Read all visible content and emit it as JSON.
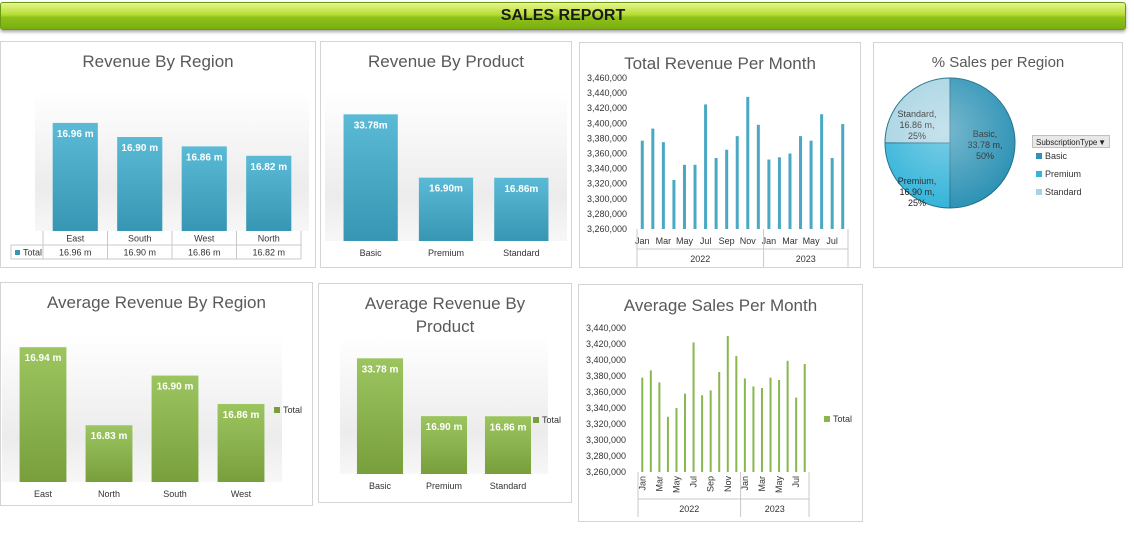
{
  "report_title": "SALES REPORT",
  "colors": {
    "blue": "#4aa8c3",
    "green": "#8ab64f",
    "banner": "#a6d22b"
  },
  "chart_data": [
    {
      "id": "rev_region",
      "type": "bar",
      "title": "Revenue By Region",
      "categories": [
        "East",
        "South",
        "West",
        "North"
      ],
      "values": [
        16.96,
        16.9,
        16.86,
        16.82
      ],
      "data_labels": [
        "16.96 m",
        "16.90 m",
        "16.86 m",
        "16.82 m"
      ],
      "data_table": {
        "row_label": "Total",
        "values": [
          "16.96 m",
          "16.90 m",
          "16.86 m",
          "16.82 m"
        ]
      },
      "ylim": [
        16.5,
        17.1
      ]
    },
    {
      "id": "rev_product",
      "type": "bar",
      "title": "Revenue By Product",
      "categories": [
        "Basic",
        "Premium",
        "Standard"
      ],
      "values": [
        33.78,
        16.9,
        16.86
      ],
      "data_labels": [
        "33.78m",
        "16.90m",
        "16.86m"
      ],
      "ylim": [
        0,
        40
      ]
    },
    {
      "id": "rev_month",
      "type": "bar",
      "title": "Total Revenue Per Month",
      "y_ticks": [
        "3,260,000",
        "3,280,000",
        "3,300,000",
        "3,320,000",
        "3,340,000",
        "3,360,000",
        "3,380,000",
        "3,400,000",
        "3,420,000",
        "3,440,000",
        "3,460,000"
      ],
      "ylim": [
        3260000,
        3460000
      ],
      "month_labels": [
        "Jan",
        "Mar",
        "May",
        "Jul",
        "Sep",
        "Nov",
        "Jan",
        "Mar",
        "May",
        "Jul"
      ],
      "years": [
        "2022",
        "2023"
      ],
      "values": [
        3377000,
        3393000,
        3375000,
        3325000,
        3345000,
        3345000,
        3425000,
        3354000,
        3365000,
        3383000,
        3435000,
        3398000,
        3352000,
        3355000,
        3360000,
        3383000,
        3377000,
        3412000,
        3354000,
        3399000
      ]
    },
    {
      "id": "pct_region",
      "type": "pie",
      "title": "% Sales per Region",
      "slices": [
        {
          "name": "Basic",
          "value": 33.78,
          "label": [
            "Basic,",
            "33.78 m,",
            "50%"
          ]
        },
        {
          "name": "Premium",
          "value": 16.9,
          "label": [
            "Premium,",
            "16.90 m,",
            "25%"
          ]
        },
        {
          "name": "Standard",
          "value": 16.86,
          "label": [
            "Standard,",
            "16.86 m,",
            "25%"
          ]
        }
      ],
      "legend_title": "SubscriptionType",
      "legend": [
        "Basic",
        "Premium",
        "Standard"
      ],
      "colors": [
        "#2f93b5",
        "#35b4d9",
        "#a7d3e2"
      ]
    },
    {
      "id": "avg_region",
      "type": "bar",
      "title": "Average Revenue By Region",
      "categories": [
        "East",
        "North",
        "South",
        "West"
      ],
      "values": [
        16.94,
        16.83,
        16.9,
        16.86
      ],
      "data_labels": [
        "16.94 m",
        "16.83 m",
        "16.90 m",
        "16.86 m"
      ],
      "legend": "Total",
      "ylim": [
        16.75,
        16.96
      ]
    },
    {
      "id": "avg_product",
      "type": "bar",
      "title": "Average Revenue By Product",
      "title_lines": [
        "Average Revenue By",
        "Product"
      ],
      "categories": [
        "Basic",
        "Premium",
        "Standard"
      ],
      "values": [
        33.78,
        16.9,
        16.86
      ],
      "data_labels": [
        "33.78 m",
        "16.90 m",
        "16.86 m"
      ],
      "legend": "Total",
      "ylim": [
        0,
        40
      ]
    },
    {
      "id": "avg_month",
      "type": "bar",
      "title": "Average Sales Per Month",
      "y_ticks": [
        "3,260,000",
        "3,280,000",
        "3,300,000",
        "3,320,000",
        "3,340,000",
        "3,360,000",
        "3,380,000",
        "3,400,000",
        "3,420,000",
        "3,440,000"
      ],
      "ylim": [
        3260000,
        3440000
      ],
      "month_labels": [
        "Jan",
        "Mar",
        "May",
        "Jul",
        "Sep",
        "Nov",
        "Jan",
        "Mar",
        "May",
        "Jul"
      ],
      "years": [
        "2022",
        "2023"
      ],
      "legend": "Total",
      "values": [
        3378000,
        3387000,
        3372000,
        3329000,
        3340000,
        3358000,
        3422000,
        3356000,
        3362000,
        3385000,
        3430000,
        3405000,
        3377000,
        3367000,
        3365000,
        3378000,
        3375000,
        3399000,
        3353000,
        3395000
      ]
    }
  ]
}
